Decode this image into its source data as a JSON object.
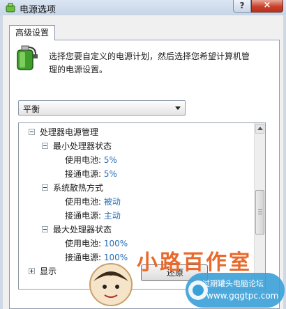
{
  "window": {
    "title": "电源选项",
    "help_label": "?",
    "close_label": "×"
  },
  "tab": {
    "label": "高级设置"
  },
  "description": "选择您要自定义的电源计划，然后选择您希望计算机管理的电源设置。",
  "plan_select": {
    "value": "平衡"
  },
  "tree": {
    "items": [
      {
        "label": "处理器电源管理",
        "toggle": "−"
      },
      {
        "label": "最小处理器状态",
        "toggle": "−"
      },
      {
        "label": "使用电池:",
        "value": "5%"
      },
      {
        "label": "接通电源:",
        "value": "5%"
      },
      {
        "label": "系统散热方式",
        "toggle": "−"
      },
      {
        "label": "使用电池:",
        "value": "被动"
      },
      {
        "label": "接通电源:",
        "value": "主动"
      },
      {
        "label": "最大处理器状态",
        "toggle": "−"
      },
      {
        "label": "使用电池:",
        "value": "100%"
      },
      {
        "label": "接通电源:",
        "value": "100%"
      },
      {
        "label": "显示",
        "toggle": "+"
      }
    ]
  },
  "buttons": {
    "restore_label": "还原"
  },
  "watermark": {
    "text": "小路百作室",
    "forum": "过期罐头电脑论坛",
    "url": "www.gqgtpc.com"
  },
  "colors": {
    "accent": "#2a6fb6",
    "watermark_orange": "#e8692b",
    "close_red": "#c9412b"
  },
  "icons": [
    "power-options-app-icon",
    "battery-plan-icon",
    "help-icon",
    "close-icon",
    "tree-collapse-icon",
    "tree-expand-icon",
    "dropdown-arrow-icon",
    "scroll-up-icon"
  ]
}
